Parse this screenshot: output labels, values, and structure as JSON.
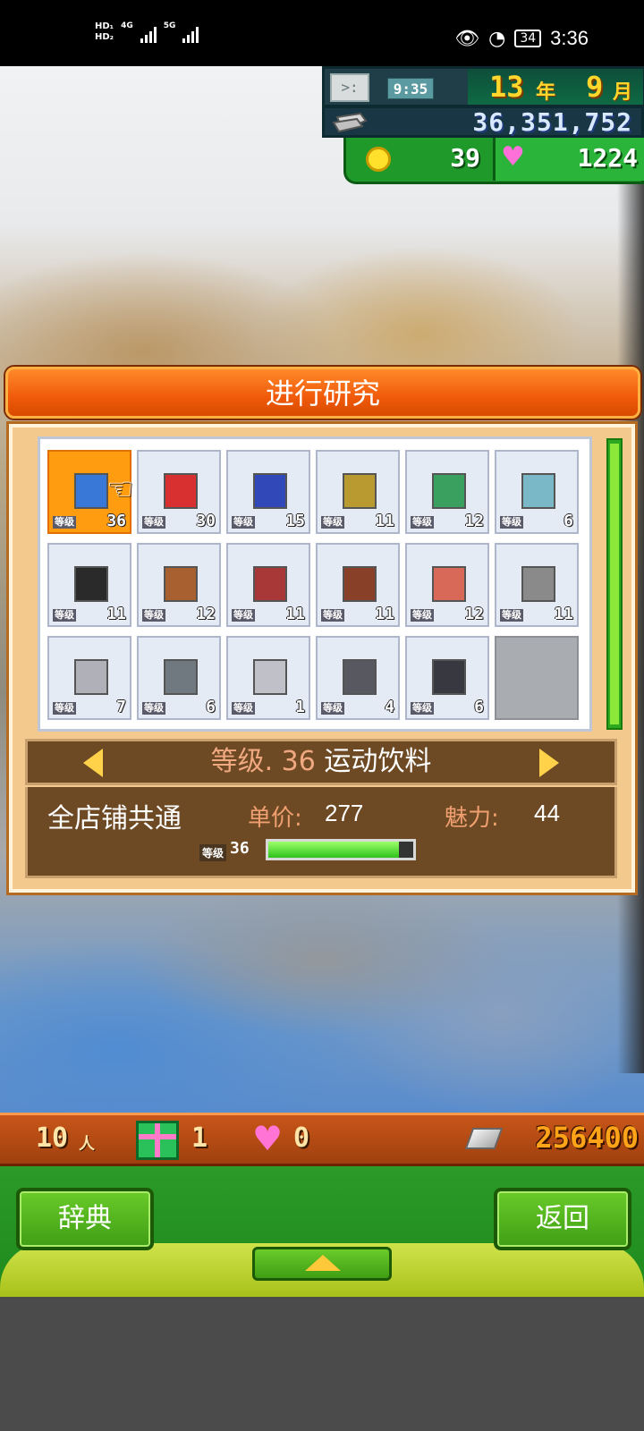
{
  "status_bar": {
    "hd1": "HD₁",
    "hd2": "HD₂",
    "net1": "4G",
    "net2": "5G",
    "battery": "34",
    "time": "3:36"
  },
  "hud": {
    "clock_face": ">:",
    "game_time": "9:35",
    "year_num": "13",
    "year_unit": "年",
    "month_num": "9",
    "month_unit": "月",
    "money": "36,351,752",
    "coins": "39",
    "hearts": "1224"
  },
  "dialog": {
    "title": "进行研究",
    "level_tag": "等级",
    "items": [
      {
        "level": "36",
        "color": "#3a78d8",
        "selected": true
      },
      {
        "level": "30",
        "color": "#d83030"
      },
      {
        "level": "15",
        "color": "#3048b8"
      },
      {
        "level": "11",
        "color": "#b89a30"
      },
      {
        "level": "12",
        "color": "#3aa060"
      },
      {
        "level": "6",
        "color": "#7ab8c8"
      },
      {
        "level": "11",
        "color": "#2a2a2a"
      },
      {
        "level": "12",
        "color": "#a86030"
      },
      {
        "level": "11",
        "color": "#a83838"
      },
      {
        "level": "11",
        "color": "#884028"
      },
      {
        "level": "12",
        "color": "#d86858"
      },
      {
        "level": "11",
        "color": "#8a8a8a"
      },
      {
        "level": "7",
        "color": "#b0b0b8"
      },
      {
        "level": "6",
        "color": "#707880"
      },
      {
        "level": "1",
        "color": "#c0c0c8"
      },
      {
        "level": "4",
        "color": "#585860"
      },
      {
        "level": "6",
        "color": "#383840"
      }
    ],
    "selection": {
      "level_label": "等级. 36",
      "name": "运动饮料"
    },
    "info": {
      "scope": "全店铺共通",
      "price_label": "单价:",
      "price_value": "277",
      "charm_label": "魅力:",
      "charm_value": "44",
      "level_tag": "等级",
      "level_num": "36",
      "progress": 0.9
    }
  },
  "bottom_status": {
    "people": "10",
    "people_unit": "人",
    "gifts": "1",
    "hearts": "0",
    "money": "256400"
  },
  "nav": {
    "dictionary": "辞典",
    "back": "返回"
  }
}
